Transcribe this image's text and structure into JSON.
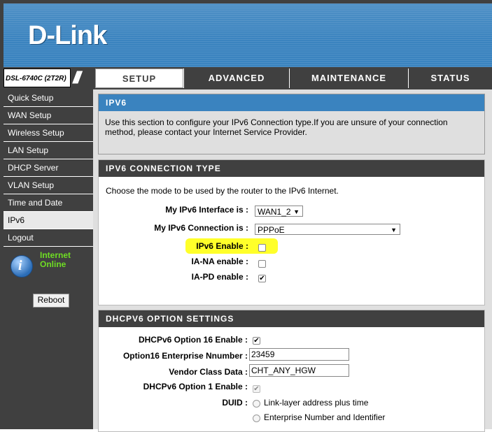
{
  "brand": {
    "logo": "D-Link",
    "model": "DSL-6740C (2T2R)"
  },
  "nav": {
    "tabs": [
      {
        "label": "SETUP"
      },
      {
        "label": "ADVANCED"
      },
      {
        "label": "MAINTENANCE"
      },
      {
        "label": "STATUS"
      }
    ]
  },
  "sidebar": {
    "items": [
      {
        "label": "Quick Setup"
      },
      {
        "label": "WAN Setup"
      },
      {
        "label": "Wireless Setup"
      },
      {
        "label": "LAN Setup"
      },
      {
        "label": "DHCP Server"
      },
      {
        "label": "VLAN Setup"
      },
      {
        "label": "Time and Date"
      },
      {
        "label": "IPv6"
      },
      {
        "label": "Logout"
      }
    ],
    "status_line1": "Internet",
    "status_line2": "Online",
    "reboot_label": "Reboot"
  },
  "ipv6_section": {
    "title": "IPV6",
    "description": "Use this section to configure your IPv6 Connection type.If you are unsure of your connection method, please contact your Internet Service Provider."
  },
  "connection_type": {
    "title": "IPV6 CONNECTION TYPE",
    "intro": "Choose the mode to be used by the router to the IPv6 Internet.",
    "interface_label": "My IPv6 Interface is :",
    "interface_value": "WAN1_2",
    "connection_label": "My IPv6 Connection is :",
    "connection_value": "PPPoE",
    "ipv6_enable_label": "IPv6 Enable :",
    "ia_na_label": "IA-NA enable :",
    "ia_pd_label": "IA-PD enable :"
  },
  "dhcpv6": {
    "title": "DHCPV6 OPTION SETTINGS",
    "opt16_label": "DHCPv6 Option 16 Enable :",
    "enterprise_label": "Option16 Enterprise Nnumber :",
    "enterprise_value": "23459",
    "vendor_label": "Vendor Class Data :",
    "vendor_value": "CHT_ANY_HGW",
    "opt1_label": "DHCPv6 Option 1 Enable :",
    "duid_label": "DUID :",
    "duid_opt1": "Link-layer address plus time",
    "duid_opt2": "Enterprise Number and Identifier"
  },
  "colors": {
    "accent": "#3a83bf",
    "nav": "#404040",
    "highlight": "#ffff2a",
    "status_green": "#6fde23"
  }
}
